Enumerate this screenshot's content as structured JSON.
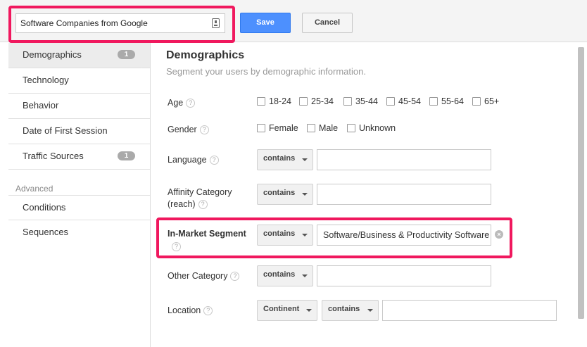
{
  "header": {
    "segment_name": "Software Companies from Google",
    "save_label": "Save",
    "cancel_label": "Cancel"
  },
  "sidebar": {
    "items": [
      {
        "label": "Demographics",
        "badge": "1"
      },
      {
        "label": "Technology"
      },
      {
        "label": "Behavior"
      },
      {
        "label": "Date of First Session"
      },
      {
        "label": "Traffic Sources",
        "badge": "1"
      }
    ],
    "advanced_heading": "Advanced",
    "advanced_items": [
      {
        "label": "Conditions"
      },
      {
        "label": "Sequences"
      }
    ]
  },
  "main": {
    "title": "Demographics",
    "subtitle": "Segment your users by demographic information.",
    "help_glyph": "?",
    "age": {
      "label": "Age",
      "options": [
        "18-24",
        "25-34",
        "35-44",
        "45-54",
        "55-64",
        "65+"
      ]
    },
    "gender": {
      "label": "Gender",
      "options": [
        "Female",
        "Male",
        "Unknown"
      ]
    },
    "language": {
      "label": "Language",
      "operator": "contains",
      "value": ""
    },
    "affinity": {
      "label_line1": "Affinity Category",
      "label_line2": "(reach)",
      "operator": "contains",
      "value": ""
    },
    "in_market": {
      "label": "In-Market Segment",
      "operator": "contains",
      "value": "Software/Business & Productivity Software"
    },
    "other_category": {
      "label": "Other Category",
      "operator": "contains",
      "value": ""
    },
    "location": {
      "label": "Location",
      "scope": "Continent",
      "operator": "contains",
      "value": ""
    }
  },
  "colors": {
    "highlight": "#f0185e",
    "save_button": "#4d90fe",
    "badge": "#aaaaaa"
  },
  "icons": {
    "name_field": "contact-card-icon",
    "help": "help-circle-icon",
    "clear": "clear-circle-icon",
    "caret": "caret-down-icon"
  }
}
